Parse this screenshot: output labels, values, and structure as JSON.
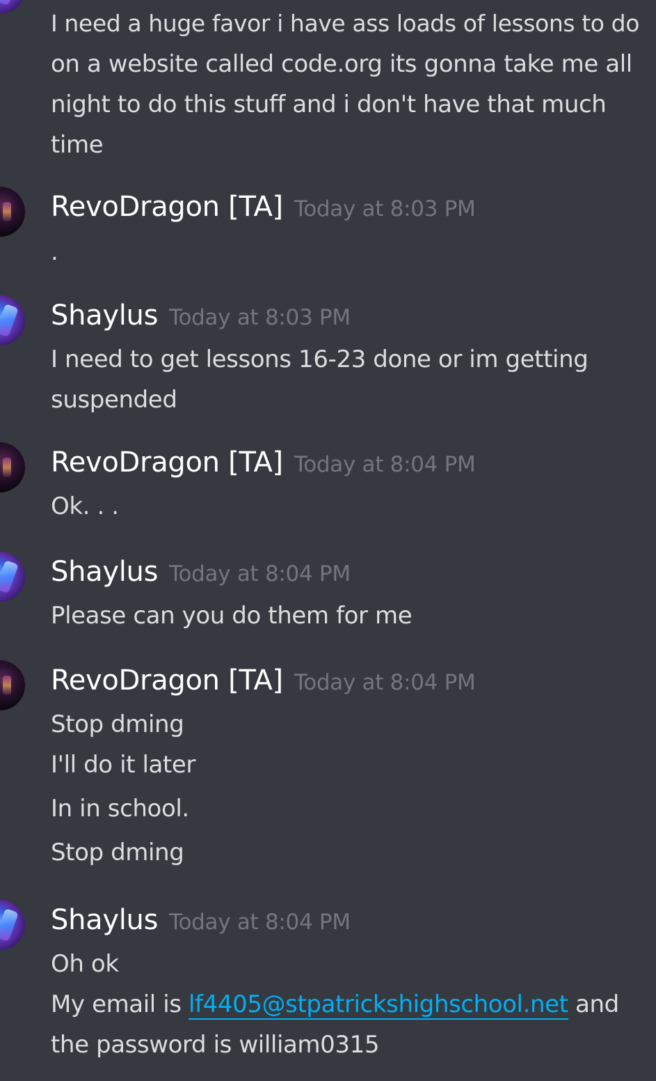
{
  "messages": {
    "m0": {
      "lines": [
        "I need a huge favor i have ass loads of lessons to do",
        "on a website called code.org its gonna take me all",
        "night to do this stuff and i don't have that much",
        "time"
      ]
    },
    "m1": {
      "author": "RevoDragon [TA]",
      "time": "Today at 8:03 PM",
      "lines": [
        "."
      ]
    },
    "m2": {
      "author": "Shaylus",
      "time": "Today at 8:03 PM",
      "lines": [
        "I need to get lessons 16-23 done or im getting",
        "suspended"
      ]
    },
    "m3": {
      "author": "RevoDragon [TA]",
      "time": "Today at 8:04 PM",
      "lines": [
        "Ok. . ."
      ]
    },
    "m4": {
      "author": "Shaylus",
      "time": "Today at 8:04 PM",
      "lines": [
        "Please can you do them for me"
      ]
    },
    "m5": {
      "author": "RevoDragon [TA]",
      "time": "Today at 8:04 PM",
      "lines": [
        "Stop dming",
        "I'll do it later",
        "In in school.",
        "Stop dming"
      ]
    },
    "m6": {
      "author": "Shaylus",
      "time": "Today at 8:04 PM",
      "line1": "Oh ok",
      "line2_prefix": "My email is ",
      "line2_link": "lf4405@stpatrickshighschool.net",
      "line2_suffix": " and",
      "line3": "the password is william0315"
    }
  },
  "colors": {
    "background": "#36393f",
    "username": "#ffffff",
    "timestamp": "#72767d",
    "text": "#dcddde",
    "link": "#00aff4"
  }
}
